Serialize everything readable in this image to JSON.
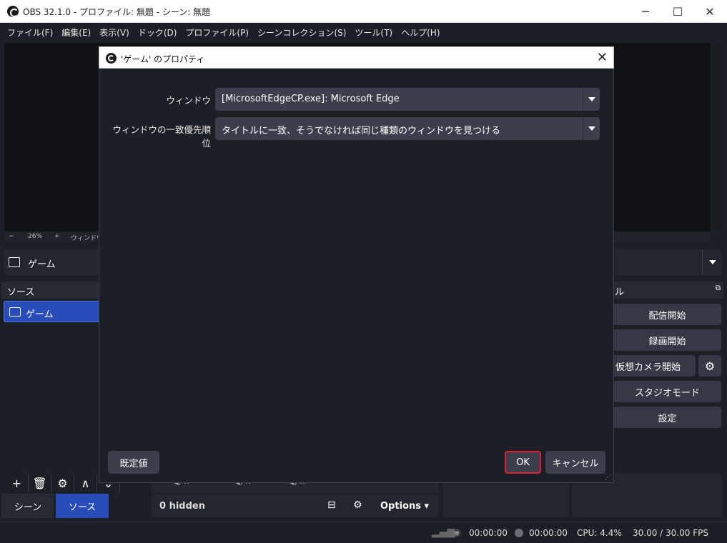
{
  "window": {
    "title": "OBS 32.1.0 - プロファイル: 無題 - シーン: 無題",
    "minimize": "─",
    "maximize": "☐",
    "close": "✕"
  },
  "menu": [
    "ファイル(F)",
    "編集(E)",
    "表示(V)",
    "ドック(D)",
    "プロファイル(P)",
    "シーンコレクション(S)",
    "ツール(T)",
    "ヘルプ(H)"
  ],
  "zoom": {
    "minus": "−",
    "value": "26%",
    "plus": "+",
    "label": "ウィンドウに"
  },
  "scene_selector": {
    "label": "ゲーム"
  },
  "sources_dock": {
    "title": "ソース",
    "items": [
      {
        "label": "ゲーム"
      }
    ],
    "toolbar": [
      "+",
      "🗑",
      "⚙",
      "∧",
      "⌄"
    ]
  },
  "bottom_tabs": [
    {
      "label": "シーン",
      "active": false
    },
    {
      "label": "ソース",
      "active": true
    }
  ],
  "mixer": {
    "hidden_label": "0 hidden",
    "options_label": "Options"
  },
  "controls": {
    "title": "ル",
    "buttons": [
      "配信開始",
      "録画開始",
      "仮想カメラ開始",
      "スタジオモード",
      "設定"
    ]
  },
  "status": {
    "stream_time": "00:00:00",
    "record_time": "00:00:00",
    "cpu": "CPU: 4.4%",
    "fps": "30.00 / 30.00 FPS"
  },
  "dialog": {
    "title": "'ゲーム' のプロパティ",
    "close": "✕",
    "fields": [
      {
        "label": "ウィンドウ",
        "value": "[MicrosoftEdgeCP.exe]: Microsoft Edge"
      },
      {
        "label": "ウィンドウの一致優先順位",
        "value": "タイトルに一致、そうでなければ同じ種類のウィンドウを見つける"
      }
    ],
    "defaults_button": "既定値",
    "ok_button": "OK",
    "cancel_button": "キャンセル"
  },
  "colors": {
    "accent": "#284cb8",
    "ok_border": "#e02030",
    "background": "#1d1f26"
  }
}
